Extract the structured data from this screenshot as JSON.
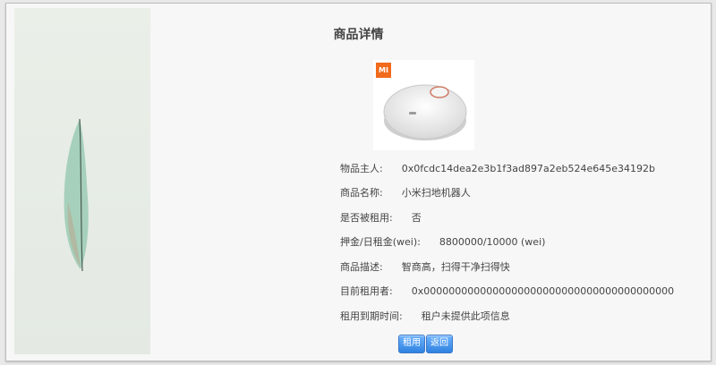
{
  "page": {
    "title": "商品详情"
  },
  "product": {
    "brand_logo_text": "MI",
    "details": [
      {
        "label": "物品主人:",
        "value": "0x0fcdc14dea2e3b1f3ad897a2eb524e645e34192b"
      },
      {
        "label": "商品名称:",
        "value": "小米扫地机器人"
      },
      {
        "label": "是否被租用:",
        "value": "否"
      },
      {
        "label": "押金/日租金(wei):",
        "value": "8800000/10000 (wei)"
      },
      {
        "label": "商品描述:",
        "value": "智商高，扫得干净扫得快"
      },
      {
        "label": "目前租用者:",
        "value": "0x0000000000000000000000000000000000000000"
      },
      {
        "label": "租用到期时间:",
        "value": "租户未提供此项信息"
      }
    ]
  },
  "actions": {
    "rent_label": "租用",
    "back_label": "返回"
  },
  "colors": {
    "button_blue": "#2e82e0",
    "mi_orange": "#f26a1b"
  }
}
